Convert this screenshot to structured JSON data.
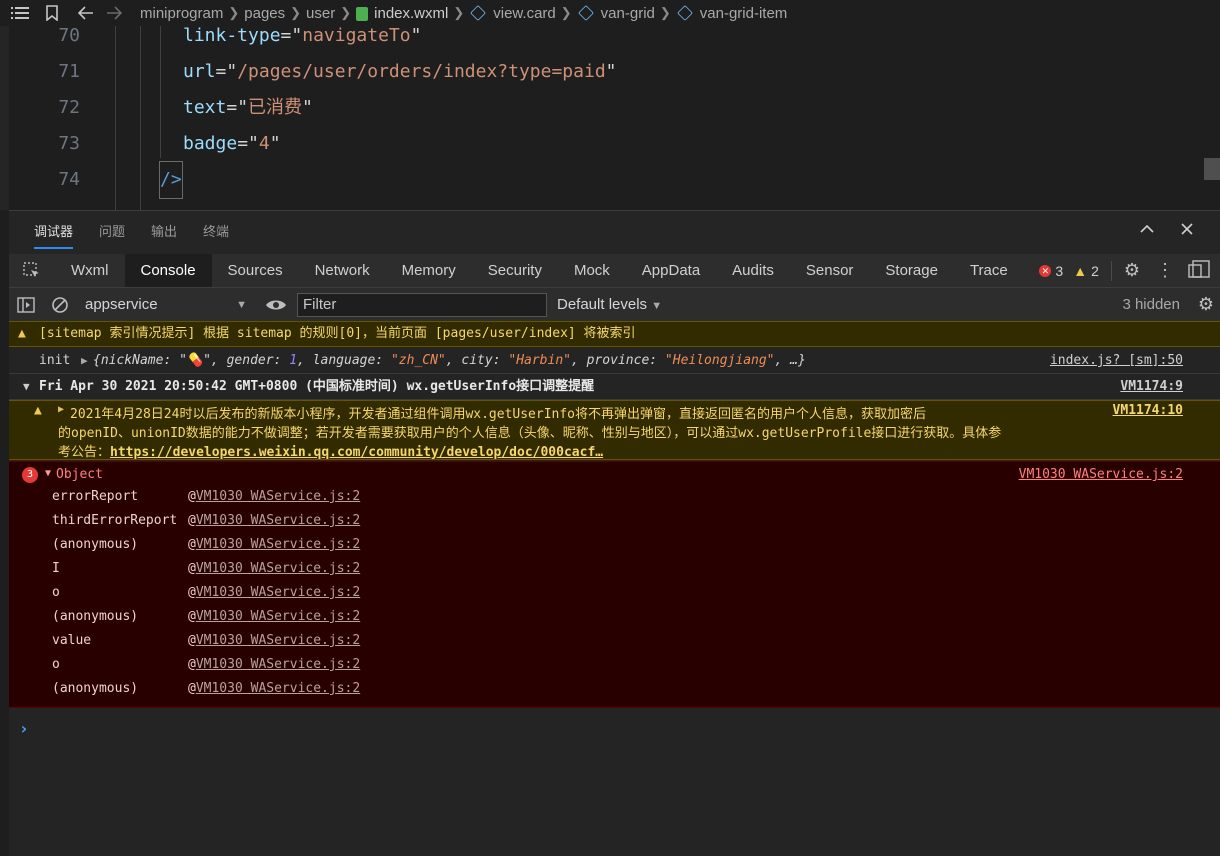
{
  "editor": {
    "breadcrumb": {
      "segments": [
        "miniprogram",
        "pages",
        "user",
        "index.wxml",
        "view.card",
        "van-grid",
        "van-grid-item"
      ]
    },
    "lines": [
      {
        "num": "70",
        "attr": "link-type",
        "eq": "=\"",
        "val": "navigateTo",
        "end": "\""
      },
      {
        "num": "71",
        "attr": "url",
        "eq": "=\"",
        "val": "/pages/user/orders/index?type=paid",
        "end": "\""
      },
      {
        "num": "72",
        "attr": "text",
        "eq": "=\"",
        "val": "已消费",
        "end": "\""
      },
      {
        "num": "73",
        "attr": "badge",
        "eq": "=\"",
        "val": "4",
        "end": "\""
      },
      {
        "num": "74",
        "closing": "/>"
      }
    ]
  },
  "panel": {
    "tabs": [
      "调试器",
      "问题",
      "输出",
      "终端"
    ],
    "active_tab": "调试器"
  },
  "devtools": {
    "tabs": [
      "Wxml",
      "Console",
      "Sources",
      "Network",
      "Memory",
      "Security",
      "Mock",
      "AppData",
      "Audits",
      "Sensor",
      "Storage",
      "Trace"
    ],
    "active": "Console",
    "error_count": "3",
    "warning_count": "2"
  },
  "toolbar": {
    "context": "appservice",
    "filter_placeholder": "Filter",
    "levels": "Default levels",
    "hidden": "3 hidden"
  },
  "console": {
    "sitemap_warning": "[sitemap 索引情况提示] 根据 sitemap 的规则[0]，当前页面 [pages/user/index] 将被索引",
    "init": {
      "label": "init",
      "obj_open": "{nickName: \"",
      "emoji": "💊",
      "obj_mid1": "\", gender: ",
      "gender": "1",
      "obj_mid2": ", language: ",
      "language": "\"zh_CN\"",
      "obj_mid3": ", city: ",
      "city": "\"Harbin\"",
      "obj_mid4": ", province: ",
      "province": "\"Heilongjiang\"",
      "obj_end": ", …}",
      "source": "index.js? [sm]:50"
    },
    "group": {
      "title": "Fri Apr 30 2021 20:50:42 GMT+0800 (中国标准时间) wx.getUserInfo接口调整提醒",
      "source": "VM1174:9"
    },
    "notice": {
      "line1": "2021年4月28日24时以后发布的新版本小程序，开发者通过组件调用wx.getUserInfo将不再弹出弹窗，直接返回匿名的用户个人信息，获取加密后",
      "line2": "的openID、unionID数据的能力不做调整；若开发者需要获取用户的个人信息（头像、昵称、性别与地区），可以通过wx.getUserProfile接口进行获取。具体参",
      "line3_prefix": "考公告：",
      "link": "https://developers.weixin.qq.com/community/develop/doc/000cacf…",
      "source": "VM1174:10"
    },
    "error": {
      "count": "3",
      "label": "Object",
      "source": "VM1030 WAService.js:2",
      "stack": [
        {
          "fn": "errorReport",
          "at": "@",
          "loc": "VM1030 WAService.js:2"
        },
        {
          "fn": "thirdErrorReport",
          "at": "@",
          "loc": "VM1030 WAService.js:2"
        },
        {
          "fn": "(anonymous)",
          "at": "@",
          "loc": "VM1030 WAService.js:2"
        },
        {
          "fn": "I",
          "at": "@",
          "loc": "VM1030 WAService.js:2"
        },
        {
          "fn": "o",
          "at": "@",
          "loc": "VM1030 WAService.js:2"
        },
        {
          "fn": "(anonymous)",
          "at": "@",
          "loc": "VM1030 WAService.js:2"
        },
        {
          "fn": "value",
          "at": "@",
          "loc": "VM1030 WAService.js:2"
        },
        {
          "fn": "o",
          "at": "@",
          "loc": "VM1030 WAService.js:2"
        },
        {
          "fn": "(anonymous)",
          "at": "@",
          "loc": "VM1030 WAService.js:2"
        }
      ]
    },
    "prompt": "›"
  },
  "colors": {
    "accent": "#2d8cf0",
    "warning_bg": "#332b00",
    "error_bg": "#290000",
    "string": "#ce9178",
    "attribute": "#9cdcfe"
  }
}
